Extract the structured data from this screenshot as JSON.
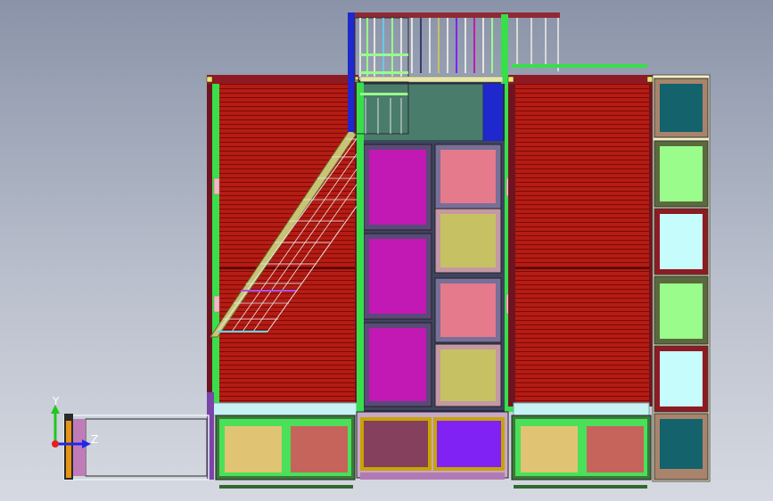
{
  "viewport": {
    "background_top": "#8a93a8",
    "background_bottom": "#d6d9e1"
  },
  "model": {
    "description_icon": "cad-container-building-model",
    "colors": {
      "cladding": "#b41c14",
      "cladding_line": "#7c0a06",
      "frame_green": "#37e04a",
      "stair": "#c8c474",
      "magenta_panel": "#c218b4",
      "pink_panel": "#e47a8c",
      "olive_panel": "#c6c264",
      "teal_panel": "#13626c",
      "light_green_panel": "#9afc8a",
      "light_cyan_panel": "#c6fcfc",
      "tan_panel": "#e0c474",
      "rose_panel": "#c6645c",
      "maroon_panel": "#84405c",
      "violet_panel": "#8022f4",
      "blue_post": "#1e28cc",
      "sage_panel": "#4a7c6c"
    }
  },
  "triad": {
    "y_label": "Y",
    "z_label": "Z",
    "y_color": "#1ec81e",
    "z_color": "#1e28e8",
    "x_color": "#e81e1e"
  }
}
